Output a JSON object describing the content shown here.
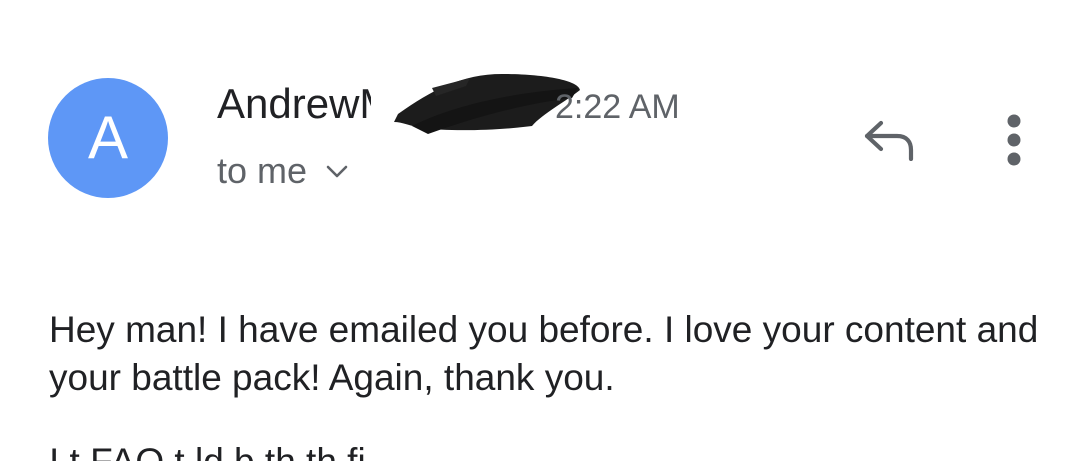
{
  "header": {
    "avatar_initial": "A",
    "avatar_color": "#5e97f6",
    "sender_name": "Andrew",
    "sender_name_partial": "M",
    "time": "2:22 AM",
    "recipient": "to me",
    "recipient_toggle_icon": "chevron-down-icon",
    "reply_icon": "reply-icon",
    "more_icon": "more-vert-icon"
  },
  "message": {
    "paragraph_1": "Hey man!  I have emailed you before.  I love your content and your battle pack! Again, thank you.",
    "paragraph_2_cut_off": "I    t     FAQ t       ld                        b  th    th    fi"
  },
  "colors": {
    "primary_text": "#202124",
    "secondary_text": "#5f6368",
    "redaction": "#1c1c1c"
  }
}
